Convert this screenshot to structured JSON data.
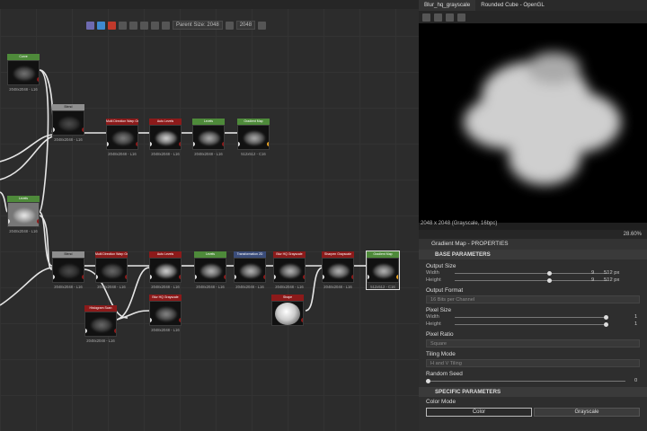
{
  "graph": {
    "toolbar": {
      "parent_size_label": "Parent Size: 2048",
      "size_value": "2048"
    },
    "nodes": [
      {
        "id": "n1",
        "title": "Curve",
        "res": "2048x2048 - L16",
        "color": "g"
      },
      {
        "id": "n2",
        "title": "Blend",
        "res": "2048x2048 - L16",
        "color": "gr"
      },
      {
        "id": "n3",
        "title": "Multi Direction Warp Grayscale",
        "res": "2048x2048 - L16",
        "color": "r"
      },
      {
        "id": "n4",
        "title": "Auto Levels",
        "res": "2048x2048 - L16",
        "color": "r"
      },
      {
        "id": "n5",
        "title": "Levels",
        "res": "2048x2048 - L16",
        "color": "g"
      },
      {
        "id": "n6",
        "title": "Gradient Map",
        "res": "512x512 - C16",
        "color": "g"
      },
      {
        "id": "n7",
        "title": "Levels",
        "res": "2048x2048 - L16",
        "color": "g"
      },
      {
        "id": "n8",
        "title": "Blend",
        "res": "2048x2048 - L16",
        "color": "gr"
      },
      {
        "id": "n9",
        "title": "Multi Direction Warp Grayscale",
        "res": "2048x2048 - L16",
        "color": "r"
      },
      {
        "id": "n10",
        "title": "Auto Levels",
        "res": "2048x2048 - L16",
        "color": "r"
      },
      {
        "id": "n11",
        "title": "Levels",
        "res": "2048x2048 - L16",
        "color": "g"
      },
      {
        "id": "n12",
        "title": "Transformation 2D",
        "res": "2048x2048 - L16",
        "color": "b"
      },
      {
        "id": "n13",
        "title": "Blur HQ Grayscale",
        "res": "2048x2048 - L16",
        "color": "r"
      },
      {
        "id": "n14",
        "title": "Sharpen Grayscale",
        "res": "2048x2048 - L16",
        "color": "r"
      },
      {
        "id": "n15",
        "title": "Gradient Map",
        "res": "512x512 - C16",
        "color": "g"
      },
      {
        "id": "n16",
        "title": "Histogram Scan",
        "res": "2048x2048 - L16",
        "color": "r"
      },
      {
        "id": "n17",
        "title": "Blur HQ Grayscale",
        "res": "2048x2048 - L16",
        "color": "r"
      },
      {
        "id": "n18",
        "title": "Shape",
        "res": "",
        "color": "r"
      }
    ]
  },
  "viewer": {
    "tabs": [
      "Blur_hq_grayscale",
      "Rounded Cube - OpenGL"
    ],
    "info": "2048 x 2048 (Grayscale, 16bpc)",
    "zoom": "28.60%"
  },
  "properties": {
    "title": "Gradient Map - PROPERTIES",
    "base_section": "BASE PARAMETERS",
    "output_size": {
      "label": "Output Size",
      "width_label": "Width",
      "width_val": "9",
      "width_px": "512 px",
      "height_label": "Height",
      "height_val": "9",
      "height_px": "512 px"
    },
    "output_format": {
      "label": "Output Format",
      "value": "16 Bits per Channel"
    },
    "pixel_size": {
      "label": "Pixel Size",
      "width_label": "Width",
      "width_val": "1",
      "height_label": "Height",
      "height_val": "1"
    },
    "pixel_ratio": {
      "label": "Pixel Ratio",
      "value": "Square"
    },
    "tiling_mode": {
      "label": "Tiling Mode",
      "value": "H and V Tiling"
    },
    "random_seed": {
      "label": "Random Seed",
      "value": "0"
    },
    "specific_section": "SPECIFIC PARAMETERS",
    "color_mode": {
      "label": "Color Mode",
      "options": [
        "Color",
        "Grayscale"
      ]
    }
  },
  "colors": {
    "green": "#4e8a3a",
    "red": "#8c1a1a",
    "grey": "#8e8e8e",
    "blue": "#3a4c7a"
  }
}
